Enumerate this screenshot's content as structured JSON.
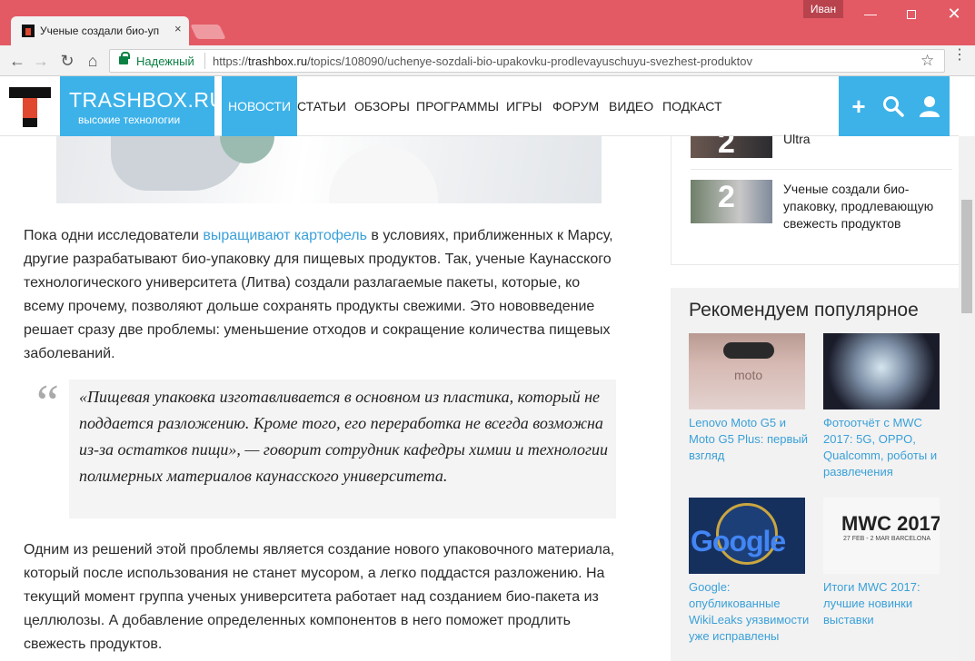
{
  "browser": {
    "user_badge": "Иван",
    "tab_title": "Ученые создали био-уп",
    "tab_close": "×",
    "secure_label": "Надежный",
    "url_scheme": "https://",
    "url_host": "trashbox.ru",
    "url_path": "/topics/108090/uchenye-sozdali-bio-upakovku-prodlevayuschuyu-svezhest-produktov",
    "win_min": "—",
    "win_close": "✕",
    "back": "←",
    "forward": "→",
    "reload": "↻",
    "home": "⌂",
    "star": "☆",
    "menu": "⋮"
  },
  "site": {
    "brand": "TRASHBOX.RU",
    "tagline": "высокие технологии",
    "nav": [
      "НОВОСТИ",
      "СТАТЬИ",
      "ОБЗОРЫ",
      "ПРОГРАММЫ",
      "ИГРЫ",
      "ФОРУМ",
      "ВИДЕО",
      "ПОДКАСТ"
    ],
    "actions": {
      "add": "+",
      "search": "⚲",
      "user": "👤"
    }
  },
  "article": {
    "para1_pre": "Пока одни исследователи ",
    "para1_link": "выращивают картофель",
    "para1_post": " в условиях, приближенных к Марсу, другие разрабатывают био-упаковку для пищевых продуктов. Так, ученые Каунасского технологического университета (Литва) создали разлагаемые пакеты, которые, ко всему прочему, позволяют дольше сохранять продукты свежими. Это нововведение решает сразу две проблемы: уменьшение отходов и сокращение количества пищевых заболеваний.",
    "quote_mark": "“",
    "quote": "«Пищевая упаковка изготавливается в основном из пластика, который не поддается разложению. Кроме того, его переработка не всегда возможна из-за остатков пищи», — говорит сотрудник кафедры химии и технологии полимерных материалов каунасского университета.",
    "para2": "Одним из решений этой проблемы является создание нового упаковочного материала, который после использования не станет мусором, а легко поддастся разложению. На текущий момент группа ученых университета работает над созданием био-пакета из целлюлозы. А добавление определенных компонентов в него поможет продлить свежесть продуктов."
  },
  "sidebar": {
    "items": [
      {
        "num": "2",
        "title": "Ultra"
      },
      {
        "num": "2",
        "title": "Ученые создали био-упаковку, продлевающую свежесть продуктов"
      }
    ],
    "popular_heading": "Рекомендуем популярное",
    "popular": [
      {
        "title": "Lenovo Moto G5 и Moto G5 Plus: первый взгляд",
        "thumb_text": "moto"
      },
      {
        "title": "Фотоотчёт с MWC 2017: 5G, OPPO, Qualcomm, роботы и развлечения",
        "thumb_text": ""
      },
      {
        "title": "Google: опубликованные WikiLeaks уязвимости уже исправлены",
        "thumb_text": "Google"
      },
      {
        "title": "Итоги MWC 2017: лучшие новинки выставки",
        "thumb_text": "MWC 2017",
        "thumb_sub": "27 FEB - 2 MAR BARCELONA"
      }
    ]
  },
  "colors": {
    "accent": "#3db2e9",
    "titlebar": "#e35a65",
    "link": "#3aa0d8",
    "logo_red": "#e0482f"
  }
}
